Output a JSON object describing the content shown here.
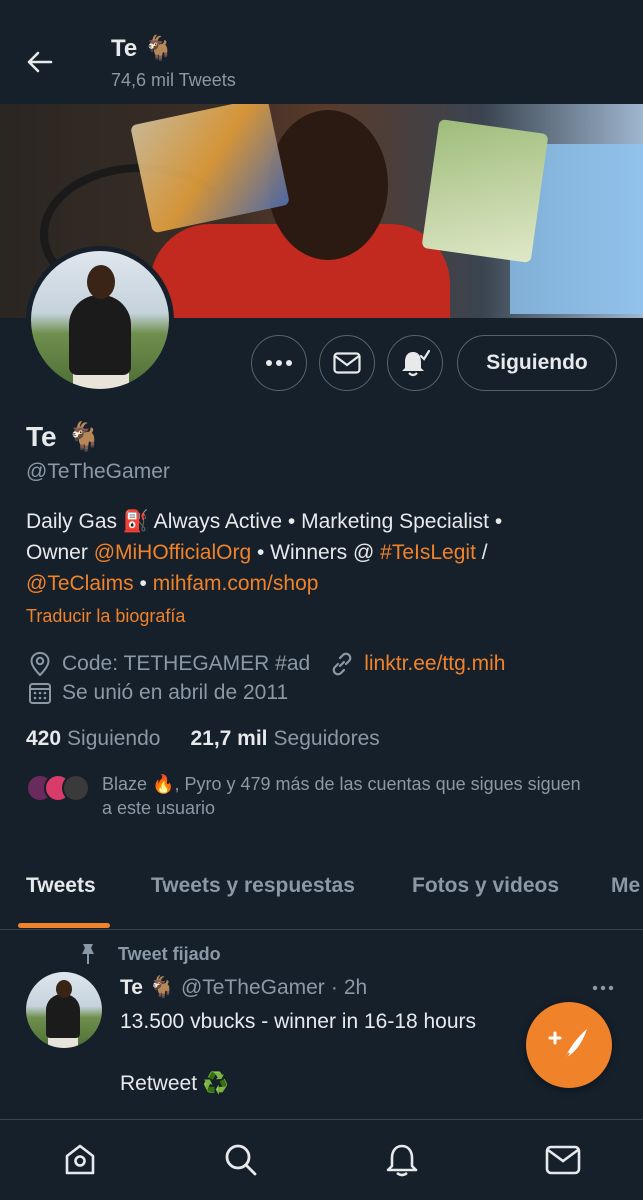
{
  "header": {
    "name": "Te 🐐",
    "tweet_count": "74,6 mil Tweets"
  },
  "profile": {
    "name": "Te",
    "name_emoji": "🐐",
    "handle": "@TeTheGamer",
    "follow_button": "Siguiendo",
    "bio": {
      "line1_a": "Daily Gas ⛽ Always Active • Marketing Specialist •",
      "line2_a": "Owner ",
      "line2_link1": "@MiHOfficialOrg",
      "line2_b": " • Winners @ ",
      "line2_link2": "#TeIsLegit",
      "line2_c": " /",
      "line3_link1": "@TeClaims",
      "line3_b": " • ",
      "line3_link2": "mihfam.com/shop"
    },
    "translate_bio": "Traducir la biografía",
    "location": "Code: TETHEGAMER #ad",
    "website": "linktr.ee/ttg.mih",
    "joined": "Se unió en abril de 2011",
    "following_count": "420",
    "following_label": "Siguiendo",
    "followers_count": "21,7 mil",
    "followers_label": "Seguidores",
    "known_followers_line1": "Blaze 🔥, Pyro y 479 más de las cuentas que sigues siguen",
    "known_followers_line2": "a este usuario"
  },
  "tabs": [
    {
      "label": "Tweets"
    },
    {
      "label": "Tweets y respuestas"
    },
    {
      "label": "Fotos y videos"
    },
    {
      "label": "Me"
    }
  ],
  "pinned_tweet": {
    "pinned_label": "Tweet fijado",
    "author_name": "Te 🐐",
    "author_handle": "@TeTheGamer",
    "separator": "·",
    "time": "2h",
    "text_line1": "13.500 vbucks - winner in 16-18 hours",
    "text_line2": "Retweet ♻️"
  },
  "colors": {
    "background": "#15202b",
    "accent": "#f0822a",
    "secondary_text": "#8b98a5",
    "border": "#38444d"
  },
  "icons": [
    "back-arrow-icon",
    "more-icon",
    "mail-icon",
    "bell-notify-icon",
    "location-icon",
    "link-icon",
    "calendar-icon",
    "pin-icon",
    "compose-icon",
    "home-icon",
    "search-icon",
    "notifications-icon",
    "messages-icon"
  ]
}
